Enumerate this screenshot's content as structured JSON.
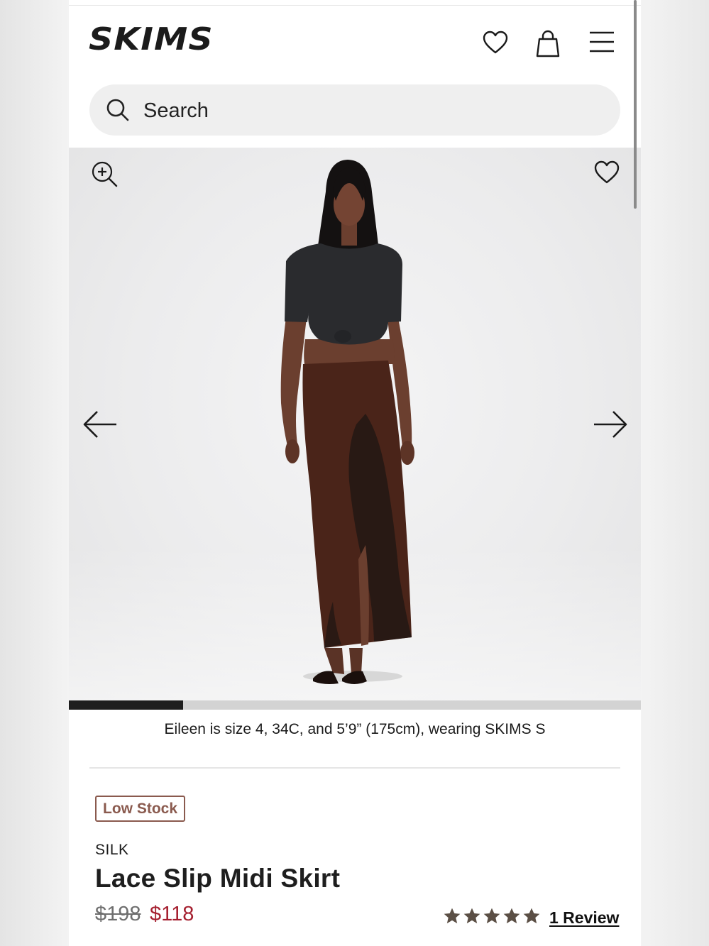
{
  "header": {
    "logo": "SKIMS",
    "search_placeholder": "Search"
  },
  "gallery": {
    "progress_fraction": 0.2,
    "caption": "Eileen is size 4, 34C, and 5’9” (175cm), wearing SKIMS S"
  },
  "product": {
    "badge": "Low Stock",
    "collection": "SILK",
    "name": "Lace Slip Midi Skirt",
    "price_original": "$198",
    "price_sale": "$118",
    "rating": 5,
    "reviews_label": "1 Review"
  },
  "colors": {
    "sale_price": "#a51f2f",
    "badge": "#8a5a4e",
    "stars": "#5b4f45"
  }
}
